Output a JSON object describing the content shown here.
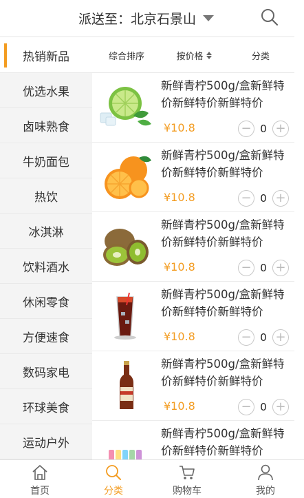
{
  "header": {
    "location_label": "派送至：北京石景山",
    "search_icon": "search-icon",
    "dropdown_icon": "caret-down-icon"
  },
  "sidebar": {
    "items": [
      {
        "label": "热销新品",
        "active": true
      },
      {
        "label": "优选水果"
      },
      {
        "label": "卤味熟食"
      },
      {
        "label": "牛奶面包"
      },
      {
        "label": "热饮"
      },
      {
        "label": "冰淇淋"
      },
      {
        "label": "饮料酒水"
      },
      {
        "label": "休闲零食"
      },
      {
        "label": "方便速食"
      },
      {
        "label": "数码家电"
      },
      {
        "label": "环球美食"
      },
      {
        "label": "运动户外"
      }
    ]
  },
  "sort": {
    "comprehensive": "综合排序",
    "by_price": "按价格",
    "category": "分类"
  },
  "products": [
    {
      "title": "新鲜青柠500g/盒新鲜特价新鲜特价新鲜特价",
      "price": "¥10.8",
      "qty": "0",
      "image": "lime-image"
    },
    {
      "title": "新鲜青柠500g/盒新鲜特价新鲜特价新鲜特价",
      "price": "¥10.8",
      "qty": "0",
      "image": "orange-image"
    },
    {
      "title": "新鲜青柠500g/盒新鲜特价新鲜特价新鲜特价",
      "price": "¥10.8",
      "qty": "0",
      "image": "kiwi-image"
    },
    {
      "title": "新鲜青柠500g/盒新鲜特价新鲜特价新鲜特价",
      "price": "¥10.8",
      "qty": "0",
      "image": "cola-glass-image"
    },
    {
      "title": "新鲜青柠500g/盒新鲜特价新鲜特价新鲜特价",
      "price": "¥10.8",
      "qty": "0",
      "image": "beer-bottle-image"
    },
    {
      "title": "新鲜青柠500g/盒新鲜特价新鲜特价新鲜特价",
      "price": "",
      "qty": "",
      "image": "drink-bottles-image"
    }
  ],
  "stepper": {
    "minus": "−",
    "plus": "+"
  },
  "tabbar": {
    "home": "首页",
    "category": "分类",
    "cart": "购物车",
    "mine": "我的"
  },
  "colors": {
    "accent": "#f39c21",
    "sidebar_bg": "#f4f4f4"
  }
}
